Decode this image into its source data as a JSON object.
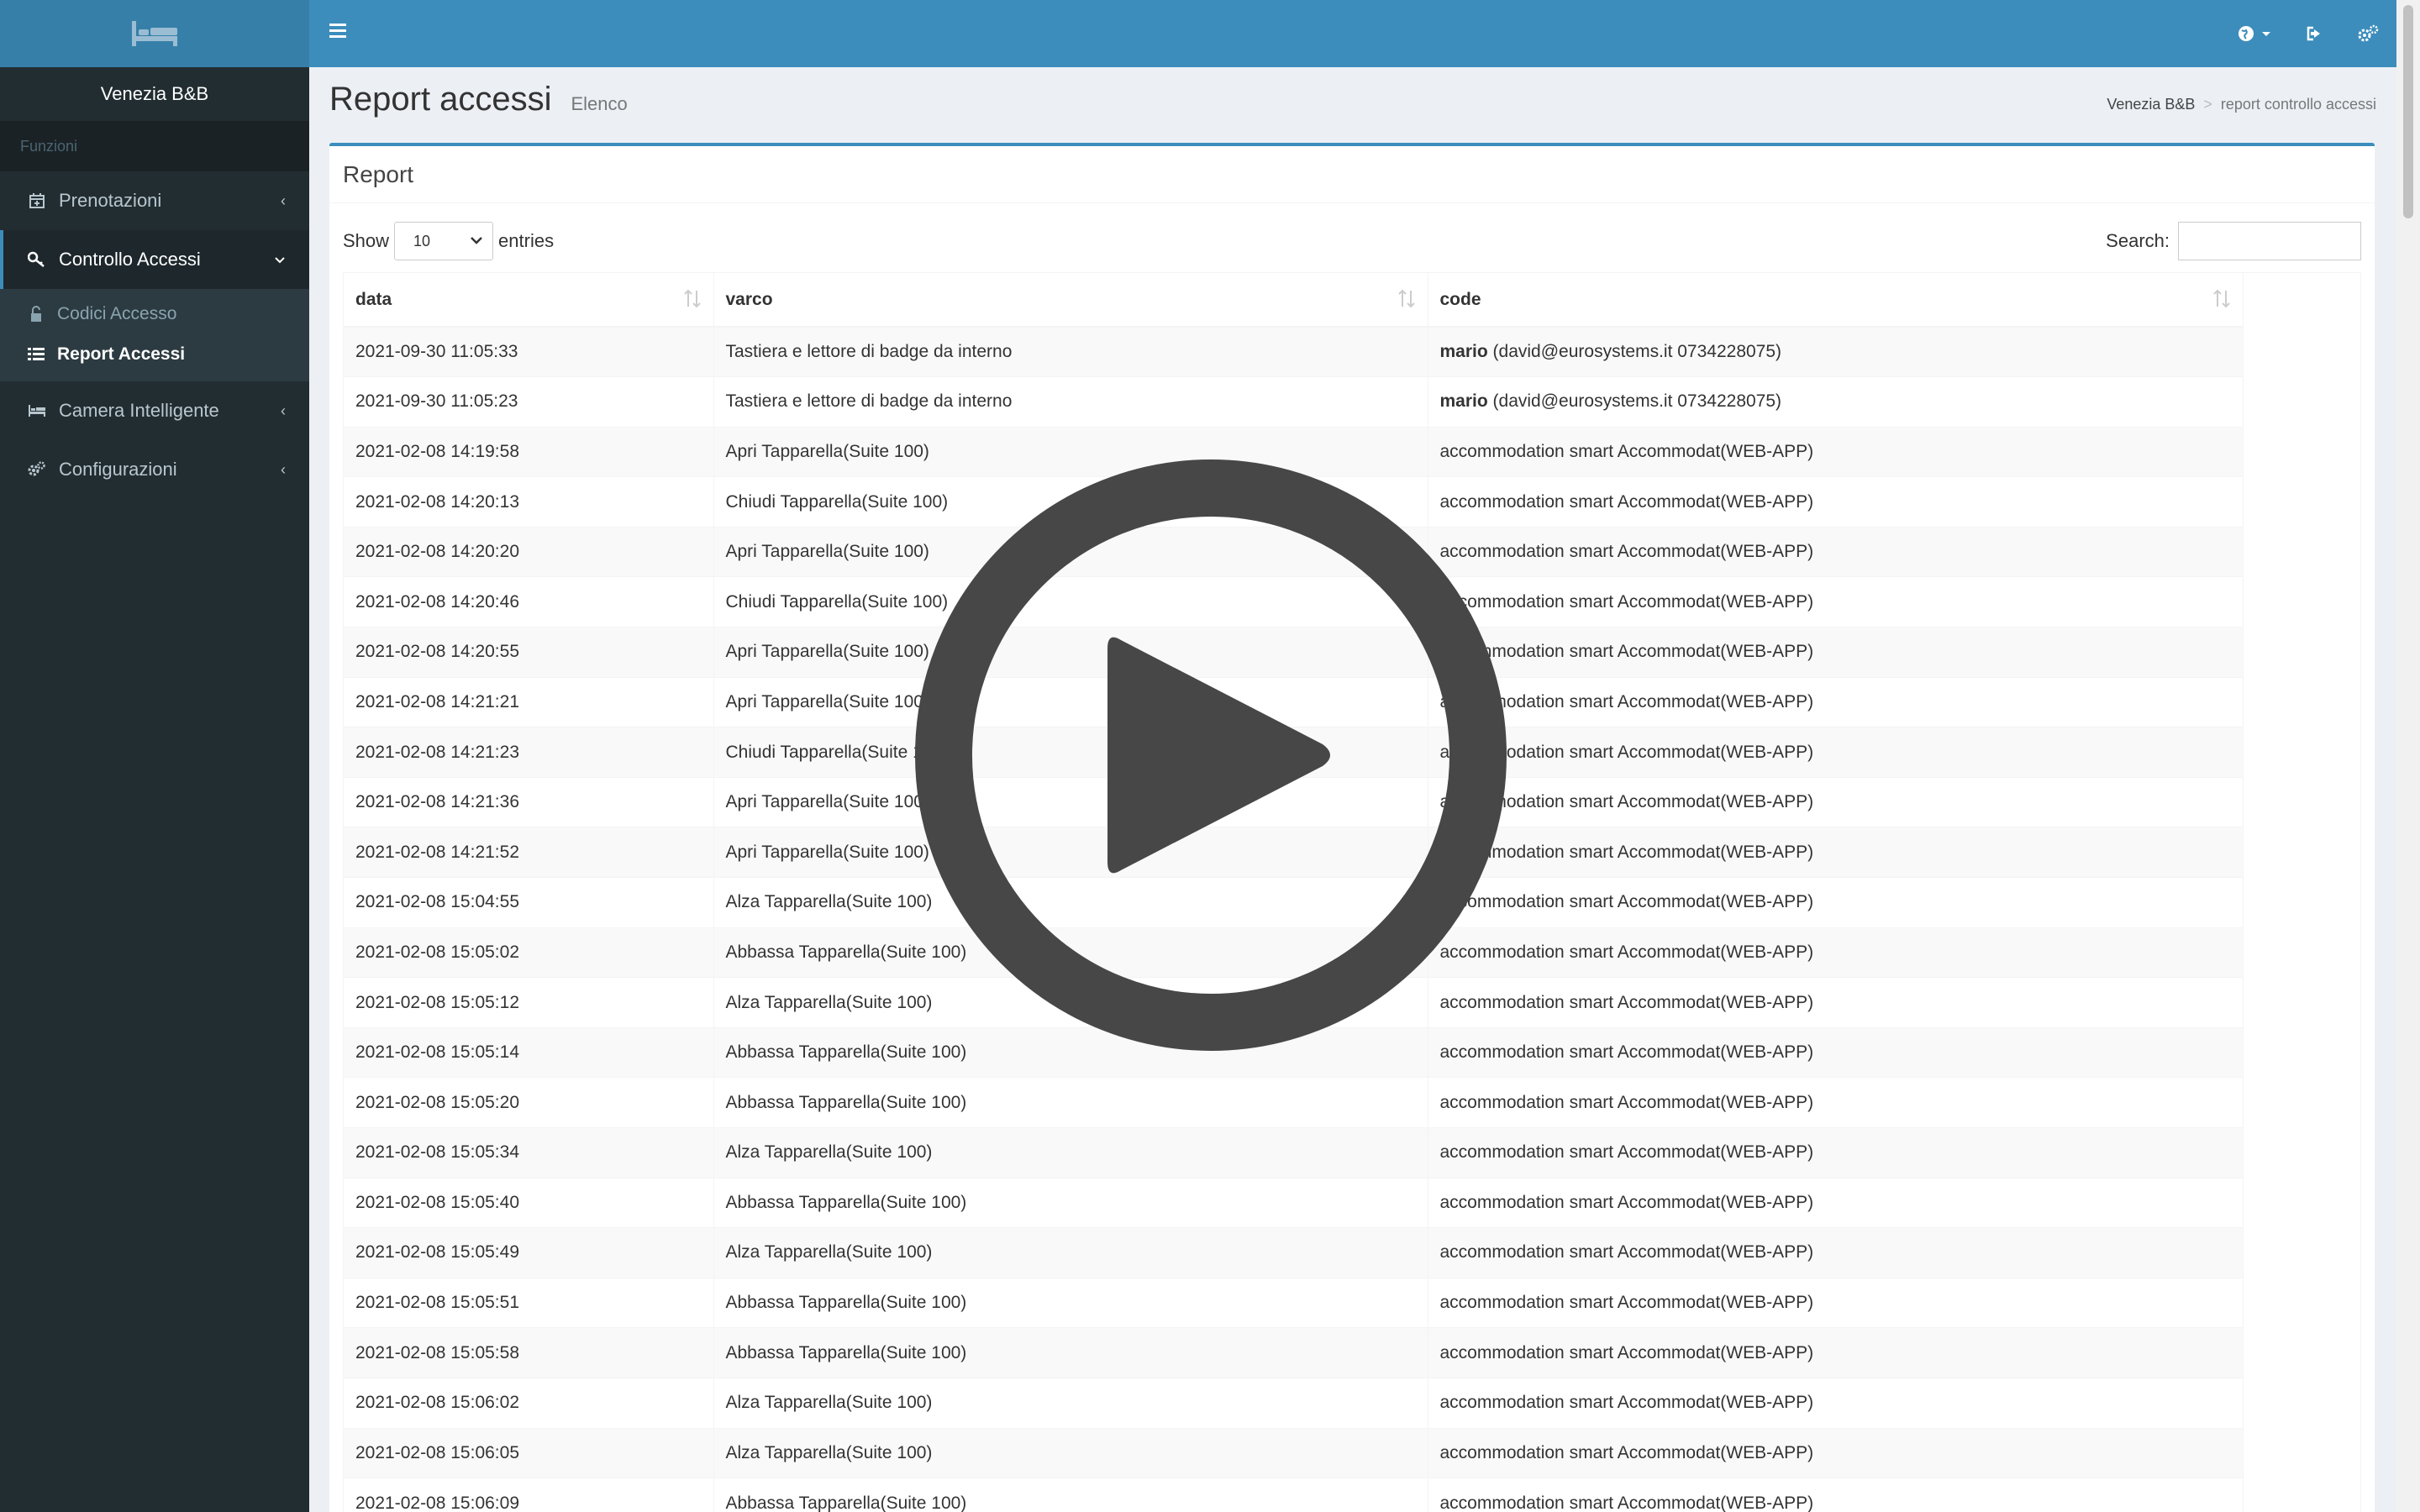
{
  "app": {
    "brand": "Venezia B&B"
  },
  "sidebar": {
    "header": "Funzioni",
    "items": [
      {
        "label": "Prenotazioni",
        "icon": "calendar-icon"
      },
      {
        "label": "Controllo Accessi",
        "icon": "key-icon",
        "active": true,
        "children": [
          {
            "label": "Codici Accesso",
            "icon": "lock-icon"
          },
          {
            "label": "Report Accessi",
            "icon": "list-icon",
            "active": true
          }
        ]
      },
      {
        "label": "Camera Intelligente",
        "icon": "bed-icon"
      },
      {
        "label": "Configurazioni",
        "icon": "cogs-icon"
      }
    ]
  },
  "topbar": {
    "icons": [
      "menu-icon",
      "globe-icon",
      "logout-icon",
      "settings-icon"
    ]
  },
  "header": {
    "title": "Report accessi",
    "subtitle": "Elenco",
    "breadcrumb": [
      "Venezia B&B",
      "report controllo accessi"
    ]
  },
  "box": {
    "title": "Report"
  },
  "controls": {
    "show_label": "Show",
    "entries_label": "entries",
    "page_size": "10",
    "search_label": "Search:"
  },
  "table": {
    "columns": [
      "data",
      "varco",
      "code"
    ],
    "rows": [
      [
        "2021-09-30 11:05:33",
        "Tastiera e lettore di badge da interno",
        "mario",
        "(david@eurosystems.it 0734228075)"
      ],
      [
        "2021-09-30 11:05:23",
        "Tastiera e lettore di badge da interno",
        "mario",
        "(david@eurosystems.it 0734228075)"
      ],
      [
        "2021-02-08 14:19:58",
        "Apri Tapparella(Suite 100)",
        "",
        "accommodation smart Accommodat(WEB-APP)"
      ],
      [
        "2021-02-08 14:20:13",
        "Chiudi Tapparella(Suite 100)",
        "",
        "accommodation smart Accommodat(WEB-APP)"
      ],
      [
        "2021-02-08 14:20:20",
        "Apri Tapparella(Suite 100)",
        "",
        "accommodation smart Accommodat(WEB-APP)"
      ],
      [
        "2021-02-08 14:20:46",
        "Chiudi Tapparella(Suite 100)",
        "",
        "accommodation smart Accommodat(WEB-APP)"
      ],
      [
        "2021-02-08 14:20:55",
        "Apri Tapparella(Suite 100)",
        "",
        "accommodation smart Accommodat(WEB-APP)"
      ],
      [
        "2021-02-08 14:21:21",
        "Apri Tapparella(Suite 100)",
        "",
        "accommodation smart Accommodat(WEB-APP)"
      ],
      [
        "2021-02-08 14:21:23",
        "Chiudi Tapparella(Suite 100)",
        "",
        "accommodation smart Accommodat(WEB-APP)"
      ],
      [
        "2021-02-08 14:21:36",
        "Apri Tapparella(Suite 100)",
        "",
        "accommodation smart Accommodat(WEB-APP)"
      ],
      [
        "2021-02-08 14:21:52",
        "Apri Tapparella(Suite 100)",
        "",
        "accommodation smart Accommodat(WEB-APP)"
      ],
      [
        "2021-02-08 15:04:55",
        "Alza Tapparella(Suite 100)",
        "",
        "accommodation smart Accommodat(WEB-APP)"
      ],
      [
        "2021-02-08 15:05:02",
        "Abbassa Tapparella(Suite 100)",
        "",
        "accommodation smart Accommodat(WEB-APP)"
      ],
      [
        "2021-02-08 15:05:12",
        "Alza Tapparella(Suite 100)",
        "",
        "accommodation smart Accommodat(WEB-APP)"
      ],
      [
        "2021-02-08 15:05:14",
        "Abbassa Tapparella(Suite 100)",
        "",
        "accommodation smart Accommodat(WEB-APP)"
      ],
      [
        "2021-02-08 15:05:20",
        "Abbassa Tapparella(Suite 100)",
        "",
        "accommodation smart Accommodat(WEB-APP)"
      ],
      [
        "2021-02-08 15:05:34",
        "Alza Tapparella(Suite 100)",
        "",
        "accommodation smart Accommodat(WEB-APP)"
      ],
      [
        "2021-02-08 15:05:40",
        "Abbassa Tapparella(Suite 100)",
        "",
        "accommodation smart Accommodat(WEB-APP)"
      ],
      [
        "2021-02-08 15:05:49",
        "Alza Tapparella(Suite 100)",
        "",
        "accommodation smart Accommodat(WEB-APP)"
      ],
      [
        "2021-02-08 15:05:51",
        "Abbassa Tapparella(Suite 100)",
        "",
        "accommodation smart Accommodat(WEB-APP)"
      ],
      [
        "2021-02-08 15:05:58",
        "Abbassa Tapparella(Suite 100)",
        "",
        "accommodation smart Accommodat(WEB-APP)"
      ],
      [
        "2021-02-08 15:06:02",
        "Alza Tapparella(Suite 100)",
        "",
        "accommodation smart Accommodat(WEB-APP)"
      ],
      [
        "2021-02-08 15:06:05",
        "Alza Tapparella(Suite 100)",
        "",
        "accommodation smart Accommodat(WEB-APP)"
      ],
      [
        "2021-02-08 15:06:09",
        "Abbassa Tapparella(Suite 100)",
        "",
        "accommodation smart Accommodat(WEB-APP)"
      ]
    ]
  },
  "overlay": {
    "icon": "play-icon"
  },
  "colors": {
    "topbar": "#3c8dbc",
    "sidebar": "#222d32",
    "accent": "#3c8dbc"
  }
}
